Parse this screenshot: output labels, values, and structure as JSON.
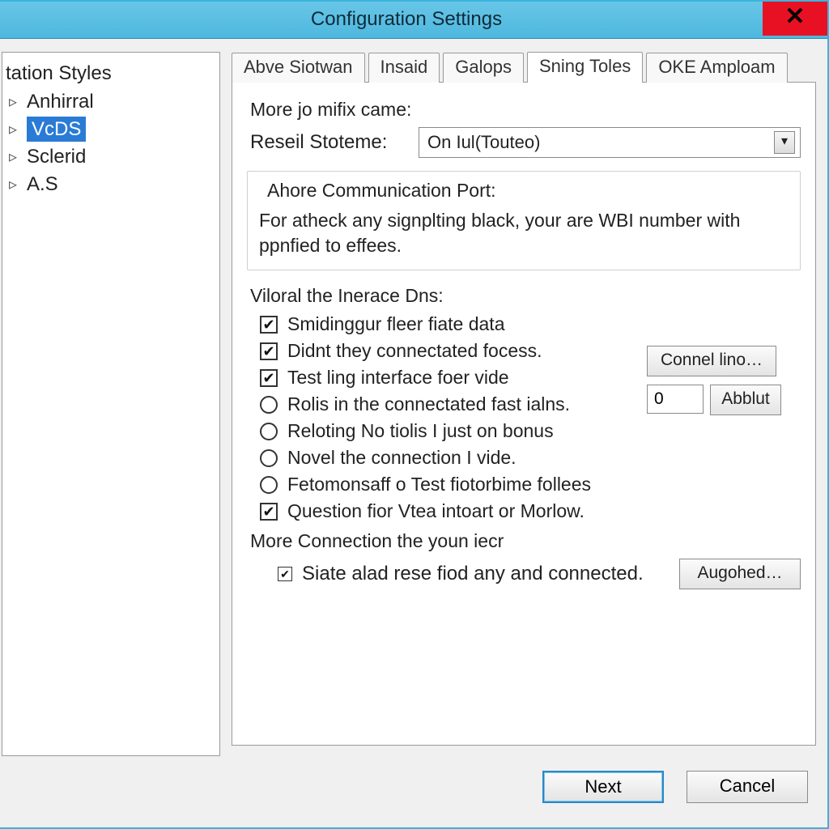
{
  "window": {
    "title": "Configuration Settings",
    "close_glyph": "✕"
  },
  "tree": {
    "root": "tation Styles",
    "items": [
      {
        "label": "Anhirral",
        "selected": false
      },
      {
        "label": "VcDS",
        "selected": true
      },
      {
        "label": "Sclerid",
        "selected": false
      },
      {
        "label": "A.S",
        "selected": false
      }
    ]
  },
  "tabs": [
    {
      "label": "Abve Siotwan",
      "active": false
    },
    {
      "label": "Insaid",
      "active": false
    },
    {
      "label": "Galops",
      "active": false
    },
    {
      "label": "Sning Toles",
      "active": true
    },
    {
      "label": "OKE Amploam",
      "active": false
    }
  ],
  "group1": {
    "heading": "More jo mifix came:",
    "field_label": "Reseil Stoteme:",
    "dropdown_value": "On Iul(Touteo)"
  },
  "comm_port": {
    "legend": "Ahore Communication Port:",
    "text": "For atheck any signplting black, your are WBI number with ppnfied to effees."
  },
  "viloral": {
    "heading": "Viloral the Inerace Dns:",
    "items": [
      {
        "type": "check",
        "checked": true,
        "label": "Smidinggur fleer fiate data"
      },
      {
        "type": "check",
        "checked": true,
        "label": "Didnt they connectated focess."
      },
      {
        "type": "check",
        "checked": true,
        "label": "Test ling interface foer vide"
      },
      {
        "type": "radio",
        "checked": false,
        "label": "Rolis in the connectated fast ialns."
      },
      {
        "type": "radio",
        "checked": false,
        "label": "Reloting No tiolis I just on bonus"
      },
      {
        "type": "radio",
        "checked": false,
        "label": "Novel the connection I vide."
      },
      {
        "type": "radio",
        "checked": false,
        "label": "Fetomonsaff o Test fiotorbime follees"
      },
      {
        "type": "check",
        "checked": true,
        "label": "Question fior Vtea intoart or Morlow."
      }
    ],
    "side": {
      "button1": "Connel lino…",
      "number_value": "0",
      "button2": "Abblut"
    }
  },
  "more_conn": {
    "heading": "More Connection the youn iecr",
    "check_label": "Siate alad rese fiod any and connected.",
    "check_checked": true,
    "button": "Augohed…"
  },
  "footer": {
    "next": "Next",
    "cancel": "Cancel"
  }
}
